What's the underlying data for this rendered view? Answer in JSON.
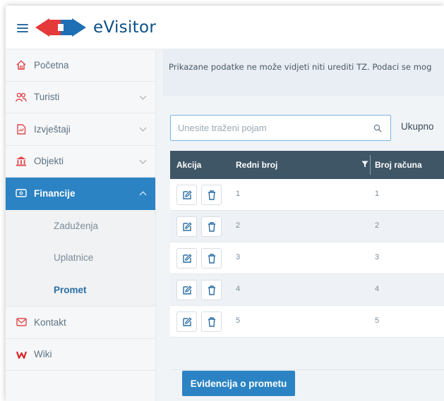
{
  "header": {
    "brand": "eVisitor",
    "logo_colors": {
      "red": "#e53a3a",
      "blue": "#1f6fb5"
    }
  },
  "sidebar": {
    "items": [
      {
        "label": "Početna",
        "icon": "home-icon"
      },
      {
        "label": "Turisti",
        "icon": "users-icon",
        "expandable": true
      },
      {
        "label": "Izvještaji",
        "icon": "report-icon",
        "expandable": true
      },
      {
        "label": "Objekti",
        "icon": "building-icon",
        "expandable": true
      },
      {
        "label": "Financije",
        "icon": "money-icon",
        "expandable": true,
        "expanded": true,
        "active": true
      },
      {
        "label": "Kontakt",
        "icon": "mail-icon"
      },
      {
        "label": "Wiki",
        "icon": "wiki-icon"
      }
    ],
    "financije_sub": [
      {
        "label": "Zaduženja"
      },
      {
        "label": "Uplatnice"
      },
      {
        "label": "Promet",
        "current": true
      }
    ]
  },
  "main": {
    "notice": "Prikazane podatke ne može vidjeti niti urediti TZ. Podaci se mog",
    "search": {
      "placeholder": "Unesite traženi pojam"
    },
    "ukupno_label": "Ukupno",
    "table": {
      "headers": {
        "akcija": "Akcija",
        "redni_broj": "Redni broj",
        "broj_racuna": "Broj računa"
      },
      "rows": [
        {
          "redni_broj": "1",
          "broj_racuna": "1"
        },
        {
          "redni_broj": "2",
          "broj_racuna": "2"
        },
        {
          "redni_broj": "3",
          "broj_racuna": "3"
        },
        {
          "redni_broj": "4",
          "broj_racuna": "4"
        },
        {
          "redni_broj": "5",
          "broj_racuna": "5"
        }
      ]
    },
    "evidencija_button": "Evidencija o prometu"
  },
  "colors": {
    "accent": "#2b83c3",
    "table_header": "#3f5666",
    "icon_blue": "#2b6ea3",
    "delete_icon": "#2b6ea3",
    "wiki_red": "#d9262c",
    "home_red": "#e0474c"
  }
}
